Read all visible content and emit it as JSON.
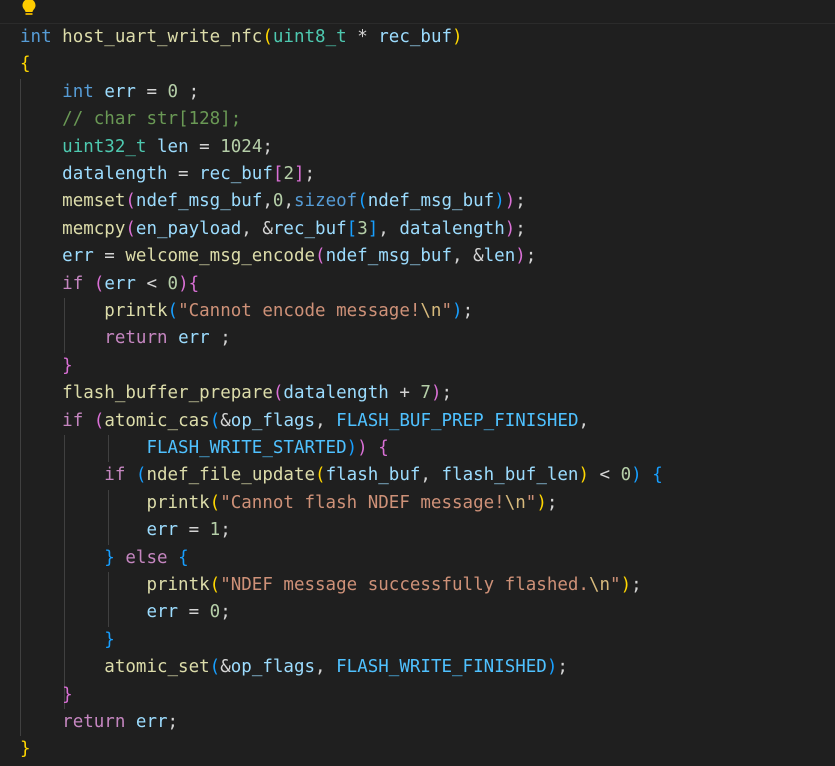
{
  "editor": {
    "lines": [
      [
        {
          "t": "int",
          "c": "k"
        },
        {
          "t": " ",
          "c": "o"
        },
        {
          "t": "host_uart_write_nfc",
          "c": "f"
        },
        {
          "t": "(",
          "c": "b1"
        },
        {
          "t": "uint8_t",
          "c": "t"
        },
        {
          "t": " * ",
          "c": "o"
        },
        {
          "t": "rec_buf",
          "c": "v"
        },
        {
          "t": ")",
          "c": "b1"
        }
      ],
      [
        {
          "t": "{",
          "c": "b1"
        }
      ],
      [
        {
          "t": "    ",
          "c": "o"
        },
        {
          "t": "int",
          "c": "k"
        },
        {
          "t": " ",
          "c": "o"
        },
        {
          "t": "err",
          "c": "v"
        },
        {
          "t": " = ",
          "c": "o"
        },
        {
          "t": "0",
          "c": "n"
        },
        {
          "t": " ;",
          "c": "o"
        }
      ],
      [
        {
          "t": "    ",
          "c": "o"
        },
        {
          "t": "// char str[128];",
          "c": "c"
        }
      ],
      [
        {
          "t": "    ",
          "c": "o"
        },
        {
          "t": "uint32_t",
          "c": "t"
        },
        {
          "t": " ",
          "c": "o"
        },
        {
          "t": "len",
          "c": "v"
        },
        {
          "t": " = ",
          "c": "o"
        },
        {
          "t": "1024",
          "c": "n"
        },
        {
          "t": ";",
          "c": "o"
        }
      ],
      [
        {
          "t": "    ",
          "c": "o"
        },
        {
          "t": "datalength",
          "c": "v"
        },
        {
          "t": " = ",
          "c": "o"
        },
        {
          "t": "rec_buf",
          "c": "v"
        },
        {
          "t": "[",
          "c": "b2"
        },
        {
          "t": "2",
          "c": "n"
        },
        {
          "t": "]",
          "c": "b2"
        },
        {
          "t": ";",
          "c": "o"
        }
      ],
      [
        {
          "t": "    ",
          "c": "o"
        },
        {
          "t": "memset",
          "c": "f"
        },
        {
          "t": "(",
          "c": "b2"
        },
        {
          "t": "ndef_msg_buf",
          "c": "v"
        },
        {
          "t": ",",
          "c": "o"
        },
        {
          "t": "0",
          "c": "n"
        },
        {
          "t": ",",
          "c": "o"
        },
        {
          "t": "sizeof",
          "c": "k"
        },
        {
          "t": "(",
          "c": "b3"
        },
        {
          "t": "ndef_msg_buf",
          "c": "v"
        },
        {
          "t": ")",
          "c": "b3"
        },
        {
          "t": ")",
          "c": "b2"
        },
        {
          "t": ";",
          "c": "o"
        }
      ],
      [
        {
          "t": "    ",
          "c": "o"
        },
        {
          "t": "memcpy",
          "c": "f"
        },
        {
          "t": "(",
          "c": "b2"
        },
        {
          "t": "en_payload",
          "c": "v"
        },
        {
          "t": ", &",
          "c": "o"
        },
        {
          "t": "rec_buf",
          "c": "v"
        },
        {
          "t": "[",
          "c": "b3"
        },
        {
          "t": "3",
          "c": "n"
        },
        {
          "t": "]",
          "c": "b3"
        },
        {
          "t": ", ",
          "c": "o"
        },
        {
          "t": "datalength",
          "c": "v"
        },
        {
          "t": ")",
          "c": "b2"
        },
        {
          "t": ";",
          "c": "o"
        }
      ],
      [
        {
          "t": "    ",
          "c": "o"
        },
        {
          "t": "err",
          "c": "v"
        },
        {
          "t": " = ",
          "c": "o"
        },
        {
          "t": "welcome_msg_encode",
          "c": "f"
        },
        {
          "t": "(",
          "c": "b2"
        },
        {
          "t": "ndef_msg_buf",
          "c": "v"
        },
        {
          "t": ", &",
          "c": "o"
        },
        {
          "t": "len",
          "c": "v"
        },
        {
          "t": ")",
          "c": "b2"
        },
        {
          "t": ";",
          "c": "o"
        }
      ],
      [
        {
          "t": "    ",
          "c": "o"
        },
        {
          "t": "if",
          "c": "kc"
        },
        {
          "t": " ",
          "c": "o"
        },
        {
          "t": "(",
          "c": "b2"
        },
        {
          "t": "err",
          "c": "v"
        },
        {
          "t": " < ",
          "c": "o"
        },
        {
          "t": "0",
          "c": "n"
        },
        {
          "t": ")",
          "c": "b2"
        },
        {
          "t": "{",
          "c": "b2"
        }
      ],
      [
        {
          "t": "        ",
          "c": "o"
        },
        {
          "t": "printk",
          "c": "f"
        },
        {
          "t": "(",
          "c": "b3"
        },
        {
          "t": "\"Cannot encode message!",
          "c": "s"
        },
        {
          "t": "\\n",
          "c": "e"
        },
        {
          "t": "\"",
          "c": "s"
        },
        {
          "t": ")",
          "c": "b3"
        },
        {
          "t": ";",
          "c": "o"
        }
      ],
      [
        {
          "t": "        ",
          "c": "o"
        },
        {
          "t": "return",
          "c": "kc"
        },
        {
          "t": " ",
          "c": "o"
        },
        {
          "t": "err",
          "c": "v"
        },
        {
          "t": " ;",
          "c": "o"
        }
      ],
      [
        {
          "t": "    ",
          "c": "o"
        },
        {
          "t": "}",
          "c": "b2"
        }
      ],
      [
        {
          "t": "    ",
          "c": "o"
        },
        {
          "t": "flash_buffer_prepare",
          "c": "f"
        },
        {
          "t": "(",
          "c": "b2"
        },
        {
          "t": "datalength",
          "c": "v"
        },
        {
          "t": " + ",
          "c": "o"
        },
        {
          "t": "7",
          "c": "n"
        },
        {
          "t": ")",
          "c": "b2"
        },
        {
          "t": ";",
          "c": "o"
        }
      ],
      [
        {
          "t": "    ",
          "c": "o"
        },
        {
          "t": "if",
          "c": "kc"
        },
        {
          "t": " ",
          "c": "o"
        },
        {
          "t": "(",
          "c": "b2"
        },
        {
          "t": "atomic_cas",
          "c": "f"
        },
        {
          "t": "(",
          "c": "b3"
        },
        {
          "t": "&",
          "c": "o"
        },
        {
          "t": "op_flags",
          "c": "v"
        },
        {
          "t": ", ",
          "c": "o"
        },
        {
          "t": "FLASH_BUF_PREP_FINISHED",
          "c": "m"
        },
        {
          "t": ",",
          "c": "o"
        }
      ],
      [
        {
          "t": "            ",
          "c": "o"
        },
        {
          "t": "FLASH_WRITE_STARTED",
          "c": "m"
        },
        {
          "t": ")",
          "c": "b3"
        },
        {
          "t": ")",
          "c": "b2"
        },
        {
          "t": " ",
          "c": "o"
        },
        {
          "t": "{",
          "c": "b2"
        }
      ],
      [
        {
          "t": "        ",
          "c": "o"
        },
        {
          "t": "if",
          "c": "kc"
        },
        {
          "t": " ",
          "c": "o"
        },
        {
          "t": "(",
          "c": "b3"
        },
        {
          "t": "ndef_file_update",
          "c": "f"
        },
        {
          "t": "(",
          "c": "b1"
        },
        {
          "t": "flash_buf",
          "c": "v"
        },
        {
          "t": ", ",
          "c": "o"
        },
        {
          "t": "flash_buf_len",
          "c": "v"
        },
        {
          "t": ")",
          "c": "b1"
        },
        {
          "t": " < ",
          "c": "o"
        },
        {
          "t": "0",
          "c": "n"
        },
        {
          "t": ")",
          "c": "b3"
        },
        {
          "t": " ",
          "c": "o"
        },
        {
          "t": "{",
          "c": "b3"
        }
      ],
      [
        {
          "t": "            ",
          "c": "o"
        },
        {
          "t": "printk",
          "c": "f"
        },
        {
          "t": "(",
          "c": "b1"
        },
        {
          "t": "\"Cannot flash NDEF message!",
          "c": "s"
        },
        {
          "t": "\\n",
          "c": "e"
        },
        {
          "t": "\"",
          "c": "s"
        },
        {
          "t": ")",
          "c": "b1"
        },
        {
          "t": ";",
          "c": "o"
        }
      ],
      [
        {
          "t": "            ",
          "c": "o"
        },
        {
          "t": "err",
          "c": "v"
        },
        {
          "t": " = ",
          "c": "o"
        },
        {
          "t": "1",
          "c": "n"
        },
        {
          "t": ";",
          "c": "o"
        }
      ],
      [
        {
          "t": "        ",
          "c": "o"
        },
        {
          "t": "}",
          "c": "b3"
        },
        {
          "t": " ",
          "c": "o"
        },
        {
          "t": "else",
          "c": "kc"
        },
        {
          "t": " ",
          "c": "o"
        },
        {
          "t": "{",
          "c": "b3"
        }
      ],
      [
        {
          "t": "            ",
          "c": "o"
        },
        {
          "t": "printk",
          "c": "f"
        },
        {
          "t": "(",
          "c": "b1"
        },
        {
          "t": "\"NDEF message successfully flashed.",
          "c": "s"
        },
        {
          "t": "\\n",
          "c": "e"
        },
        {
          "t": "\"",
          "c": "s"
        },
        {
          "t": ")",
          "c": "b1"
        },
        {
          "t": ";",
          "c": "o"
        }
      ],
      [
        {
          "t": "            ",
          "c": "o"
        },
        {
          "t": "err",
          "c": "v"
        },
        {
          "t": " = ",
          "c": "o"
        },
        {
          "t": "0",
          "c": "n"
        },
        {
          "t": ";",
          "c": "o"
        }
      ],
      [
        {
          "t": "        ",
          "c": "o"
        },
        {
          "t": "}",
          "c": "b3"
        }
      ],
      [
        {
          "t": "        ",
          "c": "o"
        },
        {
          "t": "atomic_set",
          "c": "f"
        },
        {
          "t": "(",
          "c": "b3"
        },
        {
          "t": "&",
          "c": "o"
        },
        {
          "t": "op_flags",
          "c": "v"
        },
        {
          "t": ", ",
          "c": "o"
        },
        {
          "t": "FLASH_WRITE_FINISHED",
          "c": "m"
        },
        {
          "t": ")",
          "c": "b3"
        },
        {
          "t": ";",
          "c": "o"
        }
      ],
      [
        {
          "t": "    ",
          "c": "o"
        },
        {
          "t": "}",
          "c": "b2"
        }
      ],
      [
        {
          "t": "    ",
          "c": "o"
        },
        {
          "t": "return",
          "c": "kc"
        },
        {
          "t": " ",
          "c": "o"
        },
        {
          "t": "err",
          "c": "v"
        },
        {
          "t": ";",
          "c": "o"
        }
      ],
      [
        {
          "t": "}",
          "c": "b1"
        }
      ]
    ]
  },
  "colors": {
    "background": "#1f1f1f",
    "keyword": "#569cd6",
    "control": "#c586c0",
    "function": "#dcdcaa",
    "type": "#4ec9b0",
    "variable": "#9cdcfe",
    "number": "#b5cea8",
    "string": "#ce9178",
    "comment": "#6a9955",
    "macro": "#4fc1ff",
    "bracket1": "#ffd700",
    "bracket2": "#da70d6",
    "bracket3": "#179fff"
  },
  "icons": {
    "lightbulb": "lightbulb-icon"
  }
}
